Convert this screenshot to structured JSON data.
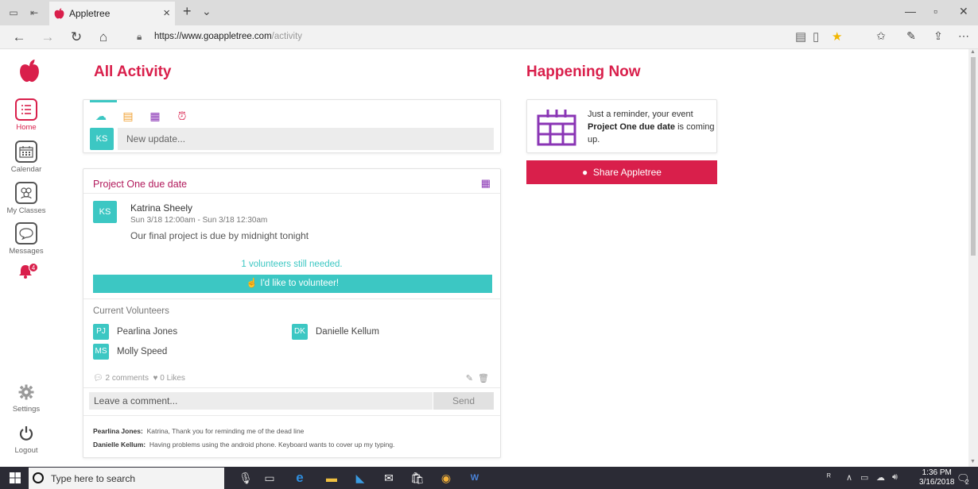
{
  "browser": {
    "tab_title": "Appletree",
    "url_host": "https://www.goappletree.com",
    "url_path": "/activity",
    "new_tab": "+",
    "tab_close": "×"
  },
  "sidebar": {
    "items": [
      {
        "label": "Home",
        "icon": "list-icon"
      },
      {
        "label": "Calendar",
        "icon": "calendar-icon"
      },
      {
        "label": "My Classes",
        "icon": "group-icon"
      },
      {
        "label": "Messages",
        "icon": "chat-icon"
      },
      {
        "label": "Settings",
        "icon": "gear-icon"
      },
      {
        "label": "Logout",
        "icon": "power-icon"
      }
    ],
    "notification_count": "4"
  },
  "activity": {
    "heading": "All Activity",
    "composer": {
      "avatar": "KS",
      "placeholder": "New update..."
    },
    "event": {
      "title": "Project One due date",
      "author_initials": "KS",
      "author": "Katrina Sheely",
      "time": "Sun 3/18 12:00am - Sun 3/18 12:30am",
      "description": "Our final project is due by midnight tonight",
      "volunteers_needed": "1 volunteers still needed.",
      "volunteer_button": "I'd like to volunteer!",
      "current_volunteers_label": "Current Volunteers",
      "volunteers": [
        {
          "initials": "PJ",
          "name": "Pearlina Jones"
        },
        {
          "initials": "DK",
          "name": "Danielle Kellum"
        },
        {
          "initials": "MS",
          "name": "Molly Speed"
        }
      ],
      "comments_count": "2 comments",
      "likes_count": "0 Likes",
      "comment_placeholder": "Leave a comment...",
      "send_label": "Send",
      "comments": [
        {
          "author": "Pearlina Jones:",
          "text": "Katrina, Thank you for reminding me of the dead line"
        },
        {
          "author": "Danielle Kellum:",
          "text": "Having problems using the android phone. Keyboard wants to cover up my typing."
        }
      ]
    }
  },
  "happening": {
    "heading": "Happening Now",
    "reminder_prefix": "Just a reminder, your event",
    "reminder_event": "Project One due date",
    "reminder_suffix": "is coming up.",
    "share_button": "Share Appletree"
  },
  "taskbar": {
    "search_placeholder": "Type here to search",
    "time": "1:36 PM",
    "date": "3/16/2018",
    "notification_badge": "2"
  },
  "colors": {
    "brand": "#d91f4b",
    "accent": "#3cc7c3",
    "event_title": "#b21a5c",
    "calendar_purple": "#8a35b5"
  }
}
